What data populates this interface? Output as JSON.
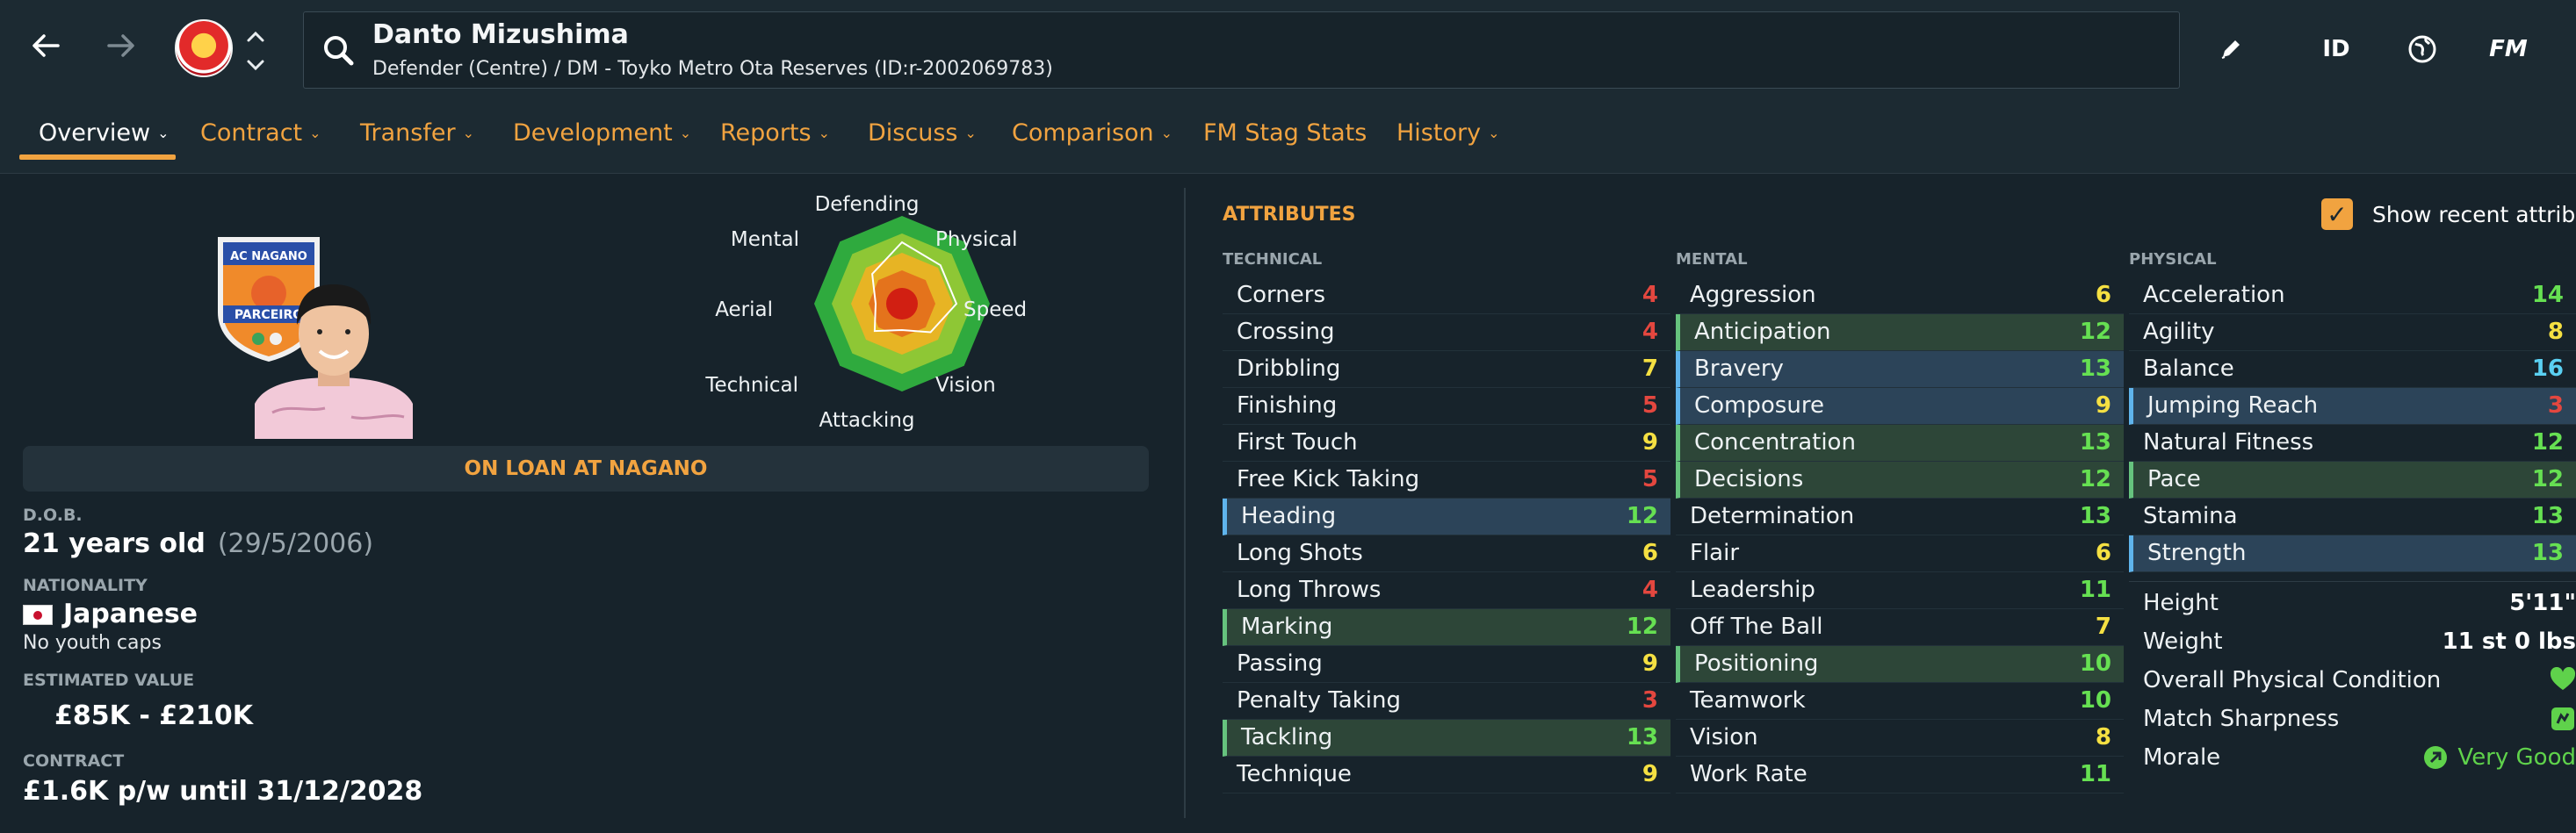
{
  "header": {
    "player_name": "Danto Mizushima",
    "player_subtitle": "Defender (Centre) / DM - Toyko Metro Ota Reserves (ID:r-2002069783)",
    "icons": [
      "back-arrow-icon",
      "forward-arrow-icon",
      "club-badge-icon",
      "up-down-arrows-icon",
      "search-icon",
      "edit-pencil-icon",
      "id-icon",
      "globe-icon",
      "fm-icon"
    ],
    "id_label": "ID",
    "fm_label": "FM"
  },
  "tabs": [
    {
      "label": "Overview",
      "active": true
    },
    {
      "label": "Contract"
    },
    {
      "label": "Transfer"
    },
    {
      "label": "Development"
    },
    {
      "label": "Reports"
    },
    {
      "label": "Discuss"
    },
    {
      "label": "Comparison"
    },
    {
      "label": "FM Stag Stats"
    },
    {
      "label": "History"
    }
  ],
  "radar": {
    "labels": [
      "Defending",
      "Physical",
      "Speed",
      "Vision",
      "Attacking",
      "Technical",
      "Aerial",
      "Mental"
    ]
  },
  "profile": {
    "crest_text_top": "AC NAGANO",
    "crest_text_bottom": "PARCEIRO",
    "loan_banner": "ON LOAN AT NAGANO",
    "dob_label": "D.O.B.",
    "dob_age": "21 years old",
    "dob_date": "(29/5/2006)",
    "nationality_label": "NATIONALITY",
    "nationality": "Japanese",
    "youth_caps": "No youth caps",
    "value_label": "ESTIMATED VALUE",
    "value": "£85K - £210K",
    "contract_label": "CONTRACT",
    "contract": "£1.6K p/w until 31/12/2028"
  },
  "attributes": {
    "title": "ATTRIBUTES",
    "show_recent_label": "Show recent attrib",
    "technical_label": "TECHNICAL",
    "mental_label": "MENTAL",
    "physical_label": "PHYSICAL",
    "technical": [
      {
        "name": "Corners",
        "value": "4"
      },
      {
        "name": "Crossing",
        "value": "4"
      },
      {
        "name": "Dribbling",
        "value": "7"
      },
      {
        "name": "Finishing",
        "value": "5"
      },
      {
        "name": "First Touch",
        "value": "9"
      },
      {
        "name": "Free Kick Taking",
        "value": "5"
      },
      {
        "name": "Heading",
        "value": "12"
      },
      {
        "name": "Long Shots",
        "value": "6"
      },
      {
        "name": "Long Throws",
        "value": "4"
      },
      {
        "name": "Marking",
        "value": "12"
      },
      {
        "name": "Passing",
        "value": "9"
      },
      {
        "name": "Penalty Taking",
        "value": "3"
      },
      {
        "name": "Tackling",
        "value": "13"
      },
      {
        "name": "Technique",
        "value": "9"
      }
    ],
    "mental": [
      {
        "name": "Aggression",
        "value": "6"
      },
      {
        "name": "Anticipation",
        "value": "12"
      },
      {
        "name": "Bravery",
        "value": "13"
      },
      {
        "name": "Composure",
        "value": "9"
      },
      {
        "name": "Concentration",
        "value": "13"
      },
      {
        "name": "Decisions",
        "value": "12"
      },
      {
        "name": "Determination",
        "value": "13"
      },
      {
        "name": "Flair",
        "value": "6"
      },
      {
        "name": "Leadership",
        "value": "11"
      },
      {
        "name": "Off The Ball",
        "value": "7"
      },
      {
        "name": "Positioning",
        "value": "10"
      },
      {
        "name": "Teamwork",
        "value": "10"
      },
      {
        "name": "Vision",
        "value": "8"
      },
      {
        "name": "Work Rate",
        "value": "11"
      }
    ],
    "physical": [
      {
        "name": "Acceleration",
        "value": "14"
      },
      {
        "name": "Agility",
        "value": "8"
      },
      {
        "name": "Balance",
        "value": "16"
      },
      {
        "name": "Jumping Reach",
        "value": "3"
      },
      {
        "name": "Natural Fitness",
        "value": "12"
      },
      {
        "name": "Pace",
        "value": "12"
      },
      {
        "name": "Stamina",
        "value": "13"
      },
      {
        "name": "Strength",
        "value": "13"
      }
    ],
    "physical_extra": {
      "height_label": "Height",
      "height": "5'11\"",
      "weight_label": "Weight",
      "weight": "11 st 0 lbs",
      "condition_label": "Overall Physical Condition",
      "sharpness_label": "Match Sharpness",
      "morale_label": "Morale",
      "morale": "Very Good"
    }
  },
  "colors": {
    "accent": "#f1a340",
    "low": "#e4473f",
    "mid": "#f5e042",
    "high": "#66e052",
    "top": "#5ad0f2"
  }
}
